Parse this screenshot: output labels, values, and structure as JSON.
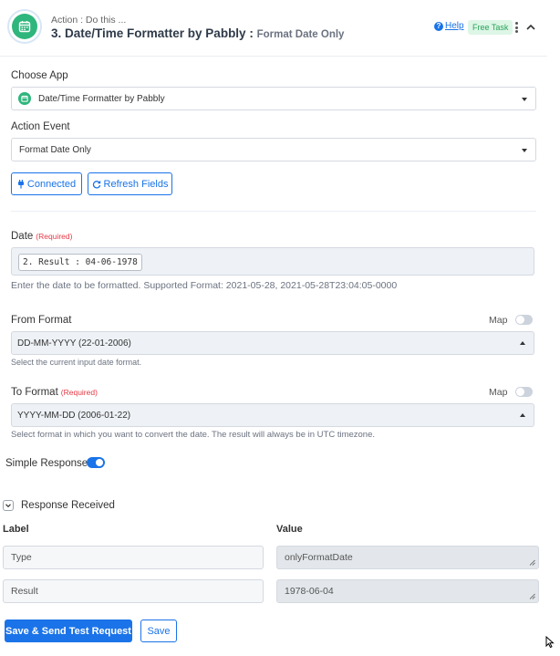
{
  "header": {
    "subtitle": "Action : Do this ...",
    "title": "3. Date/Time Formatter by Pabbly :",
    "event": "Format Date Only",
    "help_label": "Help",
    "help_icon_glyph": "?",
    "badge": "Free Task",
    "logo_icon": "calendar-icon",
    "accent_color": "#2fb67c"
  },
  "choose_app": {
    "label": "Choose App",
    "value": "Date/Time Formatter by Pabbly"
  },
  "action_event": {
    "label": "Action Event",
    "value": "Format Date Only"
  },
  "buttons": {
    "connected": "Connected",
    "refresh": "Refresh Fields",
    "save_send": "Save & Send Test Request",
    "save": "Save"
  },
  "date_field": {
    "label": "Date",
    "required": "(Required)",
    "chip": "2. Result : 04-06-1978",
    "hint": "Enter the date to be formatted. Supported Format: 2021-05-28, 2021-05-28T23:04:05-0000"
  },
  "from_format": {
    "label": "From Format",
    "map_label": "Map",
    "value": "DD-MM-YYYY (22-01-2006)",
    "hint": "Select the current input date format."
  },
  "to_format": {
    "label": "To Format",
    "required": "(Required)",
    "map_label": "Map",
    "value": "YYYY-MM-DD (2006-01-22)",
    "hint": "Select format in which you want to convert the date. The result will always be in UTC timezone."
  },
  "simple_response": {
    "label": "Simple Response",
    "enabled": true
  },
  "response": {
    "title": "Response Received",
    "label_header": "Label",
    "value_header": "Value",
    "rows": [
      {
        "label": "Type",
        "value": "onlyFormatDate"
      },
      {
        "label": "Result",
        "value": "1978-06-04"
      }
    ]
  }
}
